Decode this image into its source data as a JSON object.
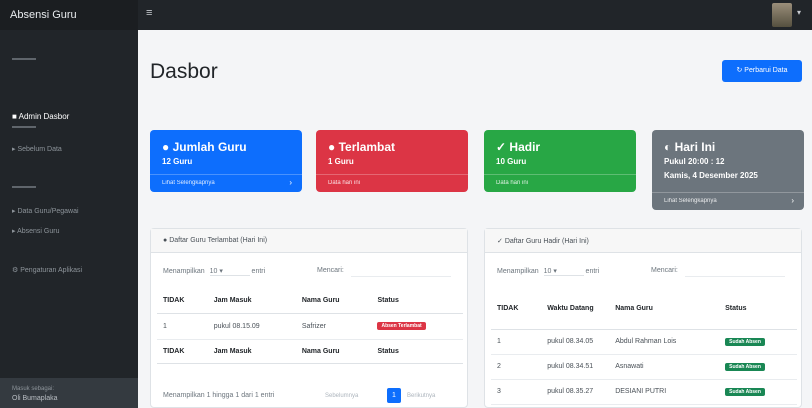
{
  "brand": "Absensi Guru",
  "sidebar": {
    "items": [
      {
        "label": "Admin Dasbor",
        "icon": "dashboard-icon"
      },
      {
        "label": "Sebelum Data"
      },
      {
        "label": "Data Guru/Pegawai"
      },
      {
        "label": "Absensi Guru"
      },
      {
        "label": "Pengaturan Aplikasi"
      }
    ],
    "footer": {
      "line1": "Masuk sebagai:",
      "line2": "Oli Bumaplaka"
    }
  },
  "main": {
    "title": "Dasbor",
    "refresh_label": "Perbarui Data"
  },
  "stats": [
    {
      "title": "Jumlah Guru",
      "value": "12 Guru",
      "link": "Lihat Selengkapnya",
      "color": "#0d6efd"
    },
    {
      "title": "Terlambat",
      "value": "1 Guru",
      "link": "Data hari ini",
      "color": "#dc3545"
    },
    {
      "title": "Hadir",
      "value": "10 Guru",
      "link": "Data hari ini",
      "color": "#28a745"
    },
    {
      "title": "Hari Ini",
      "time": "Pukul 20:00 : 12",
      "date": "Kamis, 4 Desember 2025",
      "link": "Lihat Selengkapnya",
      "color": "#6c757d"
    }
  ],
  "late_table": {
    "title": "Daftar Guru Terlambat (Hari Ini)",
    "show_label": "Menampilkan",
    "show_value": "10",
    "entries_label": "entri",
    "search_label": "Mencari:",
    "headers": [
      "TIDAK",
      "Jam Masuk",
      "Nama Guru",
      "Status"
    ],
    "rows": [
      [
        "1",
        "pukul 08.15.09",
        "Safrizer",
        "Absen Terlambat"
      ]
    ],
    "info": "Menampilkan 1 hingga 1 dari 1 entri",
    "prev": "Sebelumnya",
    "page": "1",
    "next": "Berikutnya"
  },
  "present_table": {
    "title": "Daftar Guru Hadir (Hari Ini)",
    "show_label": "Menampilkan",
    "show_value": "10",
    "entries_label": "entri",
    "search_label": "Mencari:",
    "headers": [
      "TIDAK",
      "Waktu Datang",
      "Nama Guru",
      "Status"
    ],
    "rows": [
      [
        "1",
        "pukul 08.34.05",
        "Abdul Rahman Lois",
        "Sudah Absen"
      ],
      [
        "2",
        "pukul 08.34.51",
        "Asnawati",
        "Sudah Absen"
      ],
      [
        "3",
        "pukul 08.35.27",
        "DESIANI PUTRI",
        "Sudah Absen"
      ]
    ]
  }
}
